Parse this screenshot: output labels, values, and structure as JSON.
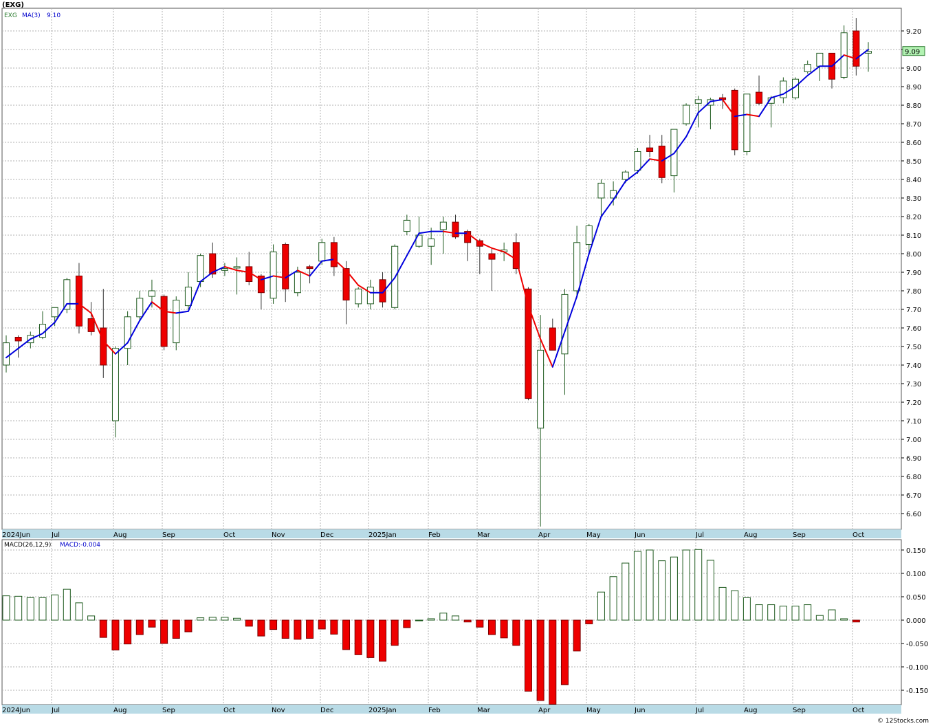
{
  "symbol_header": "(EXG)",
  "watermark": "© 12Stocks.com",
  "price_panel": {
    "legend_symbol": "EXG",
    "legend_ma": "MA(3)",
    "legend_ma_value": "9.10",
    "last_price_label": "9.09",
    "last_price_label_color": "#b2f2b2",
    "y_ticks": [
      "6.60",
      "6.70",
      "6.80",
      "6.90",
      "7.00",
      "7.10",
      "7.20",
      "7.30",
      "7.40",
      "7.50",
      "7.60",
      "7.70",
      "7.80",
      "7.90",
      "8.00",
      "8.10",
      "8.20",
      "8.30",
      "8.40",
      "8.50",
      "8.60",
      "8.70",
      "8.80",
      "8.90",
      "9.00",
      "9.10",
      "9.20"
    ]
  },
  "macd_panel": {
    "legend_name": "MACD(26,12,9)",
    "legend_value": "MACD:-0.004",
    "y_ticks": [
      "0.150",
      "0.100",
      "0.050",
      "0.000",
      "-0.050",
      "-0.100",
      "-0.150"
    ]
  },
  "x_axis_labels": [
    "2024Jun",
    "Jul",
    "Aug",
    "Sep",
    "Oct",
    "Nov",
    "Dec",
    "2025Jan",
    "Feb",
    "Mar",
    "Apr",
    "May",
    "Jun",
    "Jul",
    "Aug",
    "Sep",
    "Oct"
  ],
  "colors": {
    "up_fill": "#ffffff",
    "up_stroke": "#1e5a1e",
    "down_fill": "#ee0000",
    "ma_up": "#0000dd",
    "ma_down": "#ee0000",
    "axis_band": "#b9dbe6",
    "grid": "#b0b0b0"
  },
  "chart_data": [
    {
      "type": "candlestick",
      "title": "(EXG)",
      "ylim": [
        6.5,
        9.3
      ],
      "candles": [
        {
          "date": "2024-06-07",
          "o": 7.4,
          "h": 7.56,
          "l": 7.36,
          "c": 7.52
        },
        {
          "date": "2024-06-14",
          "o": 7.55,
          "h": 7.56,
          "l": 7.44,
          "c": 7.53
        },
        {
          "date": "2024-06-21",
          "o": 7.52,
          "h": 7.58,
          "l": 7.49,
          "c": 7.56
        },
        {
          "date": "2024-06-28",
          "o": 7.55,
          "h": 7.69,
          "l": 7.54,
          "c": 7.62
        },
        {
          "date": "2024-07-05",
          "o": 7.66,
          "h": 7.7,
          "l": 7.61,
          "c": 7.71
        },
        {
          "date": "2024-07-12",
          "o": 7.7,
          "h": 7.87,
          "l": 7.68,
          "c": 7.86
        },
        {
          "date": "2024-07-19",
          "o": 7.88,
          "h": 7.95,
          "l": 7.57,
          "c": 7.61
        },
        {
          "date": "2024-07-26",
          "o": 7.65,
          "h": 7.74,
          "l": 7.56,
          "c": 7.58
        },
        {
          "date": "2024-08-02",
          "o": 7.6,
          "h": 7.81,
          "l": 7.33,
          "c": 7.4
        },
        {
          "date": "2024-08-09",
          "o": 7.1,
          "h": 7.5,
          "l": 7.01,
          "c": 7.49
        },
        {
          "date": "2024-08-16",
          "o": 7.49,
          "h": 7.69,
          "l": 7.4,
          "c": 7.66
        },
        {
          "date": "2024-08-23",
          "o": 7.66,
          "h": 7.8,
          "l": 7.64,
          "c": 7.76
        },
        {
          "date": "2024-08-30",
          "o": 7.77,
          "h": 7.86,
          "l": 7.71,
          "c": 7.8
        },
        {
          "date": "2024-09-06",
          "o": 7.77,
          "h": 7.78,
          "l": 7.48,
          "c": 7.5
        },
        {
          "date": "2024-09-13",
          "o": 7.52,
          "h": 7.77,
          "l": 7.48,
          "c": 7.75
        },
        {
          "date": "2024-09-20",
          "o": 7.72,
          "h": 7.9,
          "l": 7.7,
          "c": 7.82
        },
        {
          "date": "2024-09-27",
          "o": 7.85,
          "h": 8.0,
          "l": 7.82,
          "c": 7.99
        },
        {
          "date": "2024-10-04",
          "o": 8.0,
          "h": 8.06,
          "l": 7.87,
          "c": 7.89
        },
        {
          "date": "2024-10-11",
          "o": 7.91,
          "h": 7.95,
          "l": 7.88,
          "c": 7.92
        },
        {
          "date": "2024-10-18",
          "o": 7.93,
          "h": 7.98,
          "l": 7.78,
          "c": 7.93
        },
        {
          "date": "2024-10-25",
          "o": 7.93,
          "h": 8.01,
          "l": 7.83,
          "c": 7.85
        },
        {
          "date": "2024-11-01",
          "o": 7.88,
          "h": 7.89,
          "l": 7.7,
          "c": 7.79
        },
        {
          "date": "2024-11-08",
          "o": 7.76,
          "h": 8.05,
          "l": 7.73,
          "c": 8.01
        },
        {
          "date": "2024-11-15",
          "o": 8.05,
          "h": 8.06,
          "l": 7.74,
          "c": 7.81
        },
        {
          "date": "2024-11-22",
          "o": 7.79,
          "h": 7.93,
          "l": 7.77,
          "c": 7.9
        },
        {
          "date": "2024-11-29",
          "o": 7.93,
          "h": 7.94,
          "l": 7.84,
          "c": 7.92
        },
        {
          "date": "2024-12-06",
          "o": 7.96,
          "h": 8.08,
          "l": 7.94,
          "c": 8.06
        },
        {
          "date": "2024-12-13",
          "o": 8.06,
          "h": 8.09,
          "l": 7.88,
          "c": 7.93
        },
        {
          "date": "2024-12-20",
          "o": 7.92,
          "h": 7.96,
          "l": 7.62,
          "c": 7.75
        },
        {
          "date": "2024-12-27",
          "o": 7.73,
          "h": 7.82,
          "l": 7.71,
          "c": 7.81
        },
        {
          "date": "2025-01-03",
          "o": 7.73,
          "h": 7.86,
          "l": 7.7,
          "c": 7.82
        },
        {
          "date": "2025-01-10",
          "o": 7.86,
          "h": 7.9,
          "l": 7.71,
          "c": 7.74
        },
        {
          "date": "2025-01-17",
          "o": 7.71,
          "h": 8.05,
          "l": 7.7,
          "c": 8.04
        },
        {
          "date": "2025-01-24",
          "o": 8.12,
          "h": 8.21,
          "l": 8.1,
          "c": 8.18
        },
        {
          "date": "2025-01-31",
          "o": 8.04,
          "h": 8.2,
          "l": 8.03,
          "c": 8.1
        },
        {
          "date": "2025-02-07",
          "o": 8.04,
          "h": 8.14,
          "l": 7.94,
          "c": 8.08
        },
        {
          "date": "2025-02-14",
          "o": 8.13,
          "h": 8.2,
          "l": 8.0,
          "c": 8.17
        },
        {
          "date": "2025-02-21",
          "o": 8.17,
          "h": 8.21,
          "l": 8.08,
          "c": 8.09
        },
        {
          "date": "2025-02-28",
          "o": 8.12,
          "h": 8.13,
          "l": 7.96,
          "c": 8.06
        },
        {
          "date": "2025-03-07",
          "o": 8.07,
          "h": 8.08,
          "l": 7.89,
          "c": 8.04
        },
        {
          "date": "2025-03-14",
          "o": 8.0,
          "h": 8.03,
          "l": 7.8,
          "c": 7.97
        },
        {
          "date": "2025-03-21",
          "o": 8.01,
          "h": 8.06,
          "l": 7.96,
          "c": 8.02
        },
        {
          "date": "2025-03-28",
          "o": 8.06,
          "h": 8.11,
          "l": 7.89,
          "c": 7.92
        },
        {
          "date": "2025-04-04",
          "o": 7.81,
          "h": 7.82,
          "l": 7.21,
          "c": 7.22
        },
        {
          "date": "2025-04-11",
          "o": 7.06,
          "h": 7.67,
          "l": 6.53,
          "c": 7.48
        },
        {
          "date": "2025-04-18",
          "o": 7.6,
          "h": 7.65,
          "l": 7.48,
          "c": 7.48
        },
        {
          "date": "2025-04-25",
          "o": 7.46,
          "h": 7.81,
          "l": 7.24,
          "c": 7.78
        },
        {
          "date": "2025-05-02",
          "o": 7.8,
          "h": 8.15,
          "l": 7.76,
          "c": 8.06
        },
        {
          "date": "2025-05-09",
          "o": 8.05,
          "h": 8.16,
          "l": 8.0,
          "c": 8.15
        },
        {
          "date": "2025-05-16",
          "o": 8.3,
          "h": 8.4,
          "l": 8.2,
          "c": 8.38
        },
        {
          "date": "2025-05-23",
          "o": 8.3,
          "h": 8.39,
          "l": 8.26,
          "c": 8.34
        },
        {
          "date": "2025-05-30",
          "o": 8.4,
          "h": 8.45,
          "l": 8.38,
          "c": 8.44
        },
        {
          "date": "2025-06-06",
          "o": 8.45,
          "h": 8.57,
          "l": 8.43,
          "c": 8.55
        },
        {
          "date": "2025-06-13",
          "o": 8.57,
          "h": 8.64,
          "l": 8.52,
          "c": 8.55
        },
        {
          "date": "2025-06-20",
          "o": 8.58,
          "h": 8.64,
          "l": 8.38,
          "c": 8.41
        },
        {
          "date": "2025-06-27",
          "o": 8.42,
          "h": 8.67,
          "l": 8.33,
          "c": 8.67
        },
        {
          "date": "2025-07-04",
          "o": 8.7,
          "h": 8.81,
          "l": 8.69,
          "c": 8.8
        },
        {
          "date": "2025-07-11",
          "o": 8.81,
          "h": 8.85,
          "l": 8.68,
          "c": 8.83
        },
        {
          "date": "2025-07-18",
          "o": 8.8,
          "h": 8.84,
          "l": 8.67,
          "c": 8.83
        },
        {
          "date": "2025-07-25",
          "o": 8.84,
          "h": 8.86,
          "l": 8.78,
          "c": 8.83
        },
        {
          "date": "2025-08-01",
          "o": 8.88,
          "h": 8.89,
          "l": 8.53,
          "c": 8.56
        },
        {
          "date": "2025-08-08",
          "o": 8.55,
          "h": 8.86,
          "l": 8.53,
          "c": 8.86
        },
        {
          "date": "2025-08-15",
          "o": 8.87,
          "h": 8.96,
          "l": 8.8,
          "c": 8.81
        },
        {
          "date": "2025-08-22",
          "o": 8.81,
          "h": 8.85,
          "l": 8.68,
          "c": 8.84
        },
        {
          "date": "2025-08-29",
          "o": 8.84,
          "h": 8.95,
          "l": 8.81,
          "c": 8.93
        },
        {
          "date": "2025-09-05",
          "o": 8.84,
          "h": 8.95,
          "l": 8.83,
          "c": 8.94
        },
        {
          "date": "2025-09-12",
          "o": 8.98,
          "h": 9.04,
          "l": 8.97,
          "c": 9.02
        },
        {
          "date": "2025-09-19",
          "o": 9.01,
          "h": 9.08,
          "l": 8.93,
          "c": 9.08
        },
        {
          "date": "2025-09-26",
          "o": 9.08,
          "h": 9.08,
          "l": 8.89,
          "c": 8.94
        },
        {
          "date": "2025-10-03",
          "o": 8.95,
          "h": 9.23,
          "l": 8.94,
          "c": 9.19
        },
        {
          "date": "2025-10-10",
          "o": 9.2,
          "h": 9.27,
          "l": 8.96,
          "c": 9.01
        },
        {
          "date": "2025-10-17",
          "o": 9.08,
          "h": 9.14,
          "l": 8.98,
          "c": 9.09
        }
      ],
      "ma3": [
        7.44,
        7.49,
        7.54,
        7.57,
        7.63,
        7.73,
        7.73,
        7.68,
        7.53,
        7.46,
        7.52,
        7.64,
        7.74,
        7.69,
        7.68,
        7.69,
        7.85,
        7.9,
        7.93,
        7.91,
        7.9,
        7.86,
        7.88,
        7.87,
        7.91,
        7.88,
        7.96,
        7.97,
        7.91,
        7.83,
        7.79,
        7.79,
        7.87,
        7.99,
        8.11,
        8.12,
        8.12,
        8.11,
        8.11,
        8.06,
        8.03,
        8.01,
        7.97,
        7.72,
        7.54,
        7.39,
        7.58,
        7.77,
        8.0,
        8.2,
        8.29,
        8.39,
        8.44,
        8.51,
        8.5,
        8.54,
        8.63,
        8.76,
        8.82,
        8.83,
        8.74,
        8.75,
        8.74,
        8.84,
        8.86,
        8.9,
        8.96,
        9.01,
        9.01,
        9.07,
        9.05,
        9.1
      ],
      "ylabel": "",
      "xlabel": ""
    },
    {
      "type": "bar",
      "title": "MACD(26,12,9)",
      "ylim": [
        -0.18,
        0.17
      ],
      "values": [
        0.052,
        0.051,
        0.048,
        0.048,
        0.054,
        0.066,
        0.037,
        0.009,
        -0.037,
        -0.064,
        -0.051,
        -0.031,
        -0.015,
        -0.05,
        -0.039,
        -0.025,
        0.005,
        0.006,
        0.006,
        0.004,
        -0.013,
        -0.034,
        -0.02,
        -0.039,
        -0.041,
        -0.039,
        -0.019,
        -0.03,
        -0.063,
        -0.074,
        -0.08,
        -0.088,
        -0.054,
        -0.016,
        0.0,
        0.003,
        0.015,
        0.009,
        -0.004,
        -0.015,
        -0.031,
        -0.038,
        -0.054,
        -0.152,
        -0.172,
        -0.18,
        -0.138,
        -0.066,
        -0.008,
        0.06,
        0.093,
        0.122,
        0.147,
        0.15,
        0.127,
        0.135,
        0.15,
        0.151,
        0.128,
        0.07,
        0.063,
        0.048,
        0.033,
        0.033,
        0.03,
        0.03,
        0.033,
        0.01,
        0.022,
        0.003,
        -0.004
      ]
    }
  ]
}
